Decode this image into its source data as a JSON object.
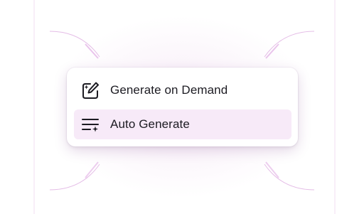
{
  "menu": {
    "items": [
      {
        "label": "Generate on Demand",
        "icon": "edit-sparkle-icon",
        "selected": false
      },
      {
        "label": "Auto Generate",
        "icon": "list-sparkle-icon",
        "selected": true
      }
    ]
  },
  "colors": {
    "highlight": "#f7eaf8",
    "text": "#1c1b22",
    "accent_lines": "#e7c3e9"
  }
}
